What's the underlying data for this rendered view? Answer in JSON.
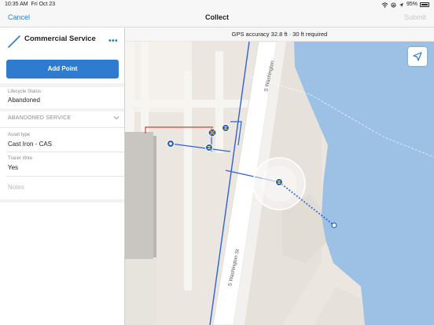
{
  "status_bar": {
    "time": "10:35 AM",
    "date": "Fri Oct 23",
    "battery_percent": "95%",
    "battery_level": 0.95
  },
  "nav": {
    "cancel_label": "Cancel",
    "title": "Collect",
    "submit_label": "Submit"
  },
  "feature": {
    "title": "Commercial Service",
    "more_icon": "ellipsis-icon",
    "line_icon": "line-icon"
  },
  "add_point_label": "Add Point",
  "fields": {
    "lifecycle_label": "Lifecycle Status",
    "lifecycle_value": "Abandoned",
    "group_title": "ABANDONED SERVICE",
    "asset_type_label": "Asset type",
    "asset_type_value": "Cast Iron - CAS",
    "tracer_wire_label": "Tracer Wire",
    "tracer_wire_value": "Yes",
    "notes_placeholder": "Notes"
  },
  "map": {
    "gps_text": "GPS accuracy 32.8 ft  ·  30 ft required",
    "street_label_upper": "S Washington",
    "street_label_lower": "S Washington St",
    "locate_icon": "location-arrow-icon",
    "colors": {
      "water": "#9dc1e4",
      "utility_line": "#2f62d6",
      "abandoned_line": "#e03c31",
      "sketch": "#2f62d6"
    }
  }
}
